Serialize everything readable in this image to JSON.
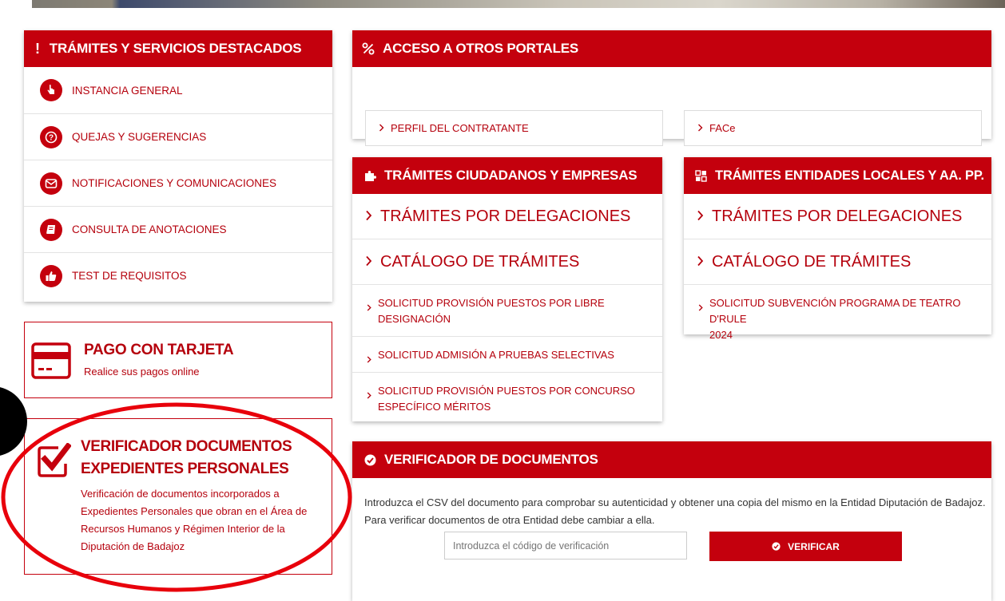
{
  "colors": {
    "brand_red": "#c4000d",
    "link_red": "#b5000c",
    "border": "#dcdcdc"
  },
  "featured": {
    "title": "TRÁMITES Y SERVICIOS DESTACADOS",
    "items": [
      {
        "label": "INSTANCIA GENERAL",
        "icon": "pointing-hand-icon"
      },
      {
        "label": "QUEJAS Y SUGERENCIAS",
        "icon": "question-icon"
      },
      {
        "label": "NOTIFICACIONES Y COMUNICACIONES",
        "icon": "envelope-icon"
      },
      {
        "label": "CONSULTA DE ANOTACIONES",
        "icon": "book-icon"
      },
      {
        "label": "TEST DE REQUISITOS",
        "icon": "thumbs-up-icon"
      }
    ]
  },
  "payment": {
    "title": "PAGO CON TARJETA",
    "subtitle": "Realice sus pagos online",
    "icon": "credit-card-icon"
  },
  "verifier_personal": {
    "title_line1": "VERIFICADOR DOCUMENTOS",
    "title_line2": "EXPEDIENTES PERSONALES",
    "desc_line1": "Verificación de documentos incorporados a",
    "desc_line2": "Expedientes Personales que obran en el Área de",
    "desc_line3": "Recursos Humanos y Régimen Interior de la",
    "desc_line4": "Diputación de Badajoz",
    "icon": "checkbox-icon"
  },
  "portals": {
    "title": "ACCESO A OTROS PORTALES",
    "icon": "link-icon",
    "links": [
      "PERFIL DEL CONTRATANTE",
      "FACe"
    ]
  },
  "citizens": {
    "title": "TRÁMITES CIUDADANOS Y EMPRESAS",
    "icon": "puzzle-icon",
    "big_links": [
      "TRÁMITES POR DELEGACIONES",
      "CATÁLOGO DE TRÁMITES"
    ],
    "small_links": [
      {
        "line1": "SOLICITUD PROVISIÓN PUESTOS POR LIBRE",
        "line2": "DESIGNACIÓN"
      },
      {
        "line1": "SOLICITUD ADMISIÓN A PRUEBAS SELECTIVAS",
        "line2": ""
      },
      {
        "line1": "SOLICITUD PROVISIÓN PUESTOS POR CONCURSO",
        "line2": "ESPECÍFICO MÉRITOS"
      }
    ]
  },
  "entities": {
    "title": "TRÁMITES ENTIDADES LOCALES Y AA. PP.",
    "icon": "grid-icon",
    "big_links": [
      "TRÁMITES POR DELEGACIONES",
      "CATÁLOGO DE TRÁMITES"
    ],
    "small_links": [
      {
        "line1": "SOLICITUD SUBVENCIÓN PROGRAMA DE TEATRO D'RULE",
        "line2": "2024"
      }
    ]
  },
  "verifier": {
    "title": "VERIFICADOR DE DOCUMENTOS",
    "icon": "check-circle-icon",
    "desc_line1": "Introduzca el CSV del documento para comprobar su autenticidad y obtener una copia del mismo en la Entidad Diputación de Badajoz.",
    "desc_line2": "Para verificar documentos de otra Entidad debe cambiar a ella.",
    "input_placeholder": "Introduzca el código de verificación",
    "button_label": "VERIFICAR"
  }
}
